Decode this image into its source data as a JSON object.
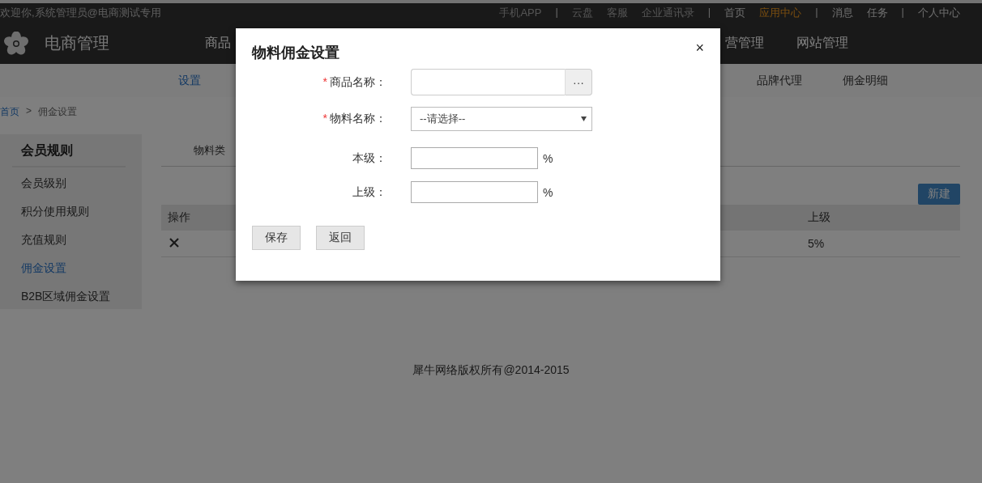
{
  "top_bar": {
    "welcome": "欢迎你,系统管理员@电商测试专用",
    "links": [
      {
        "label": "手机APP",
        "disabled": true,
        "selected": false
      },
      {
        "label": "|",
        "kind": "sep"
      },
      {
        "label": "云盘",
        "disabled": true,
        "selected": false
      },
      {
        "label": "客服",
        "disabled": true,
        "selected": false
      },
      {
        "label": "企业通讯录",
        "disabled": true,
        "selected": false
      },
      {
        "label": "|",
        "kind": "sep"
      },
      {
        "label": "首页",
        "disabled": false,
        "selected": false
      },
      {
        "label": "应用中心",
        "disabled": false,
        "selected": true
      },
      {
        "label": "|",
        "kind": "sep"
      },
      {
        "label": "消息",
        "disabled": false,
        "selected": false
      },
      {
        "label": "任务",
        "disabled": false,
        "selected": false
      },
      {
        "label": "|",
        "kind": "sep"
      },
      {
        "label": "个人中心",
        "disabled": false,
        "selected": false
      }
    ]
  },
  "header": {
    "app_name": "电商管理",
    "nav": [
      "商品",
      "营管理",
      "网站管理"
    ]
  },
  "sub_nav": [
    {
      "label": "设置",
      "selected": true
    },
    {
      "label": "品牌代理",
      "selected": false
    },
    {
      "label": "佣金明细",
      "selected": false
    }
  ],
  "breadcrumb": [
    "首页",
    ">",
    "佣金设置"
  ],
  "sidebar": {
    "title": "会员规则",
    "items": [
      {
        "label": "会员级别",
        "selected": false
      },
      {
        "label": "积分使用规则",
        "selected": false
      },
      {
        "label": "充值规则",
        "selected": false
      },
      {
        "label": "佣金设置",
        "selected": true
      },
      {
        "label": "B2B区域佣金设置",
        "selected": false
      }
    ]
  },
  "content": {
    "tab": "物料类",
    "new_button": "新建",
    "table": {
      "columns": [
        "操作",
        "上级"
      ],
      "rows": [
        {
          "column_2": "5%"
        }
      ]
    }
  },
  "footer": "犀牛网络版权所有@2014-2015",
  "dialog": {
    "title": "物料佣金设置",
    "close": "×",
    "fields": [
      {
        "label": "商品名称：",
        "required_mark": "*",
        "kind": "picker",
        "button": "···"
      },
      {
        "label": "物料名称：",
        "required_mark": "*",
        "kind": "select",
        "value": "--请选择--"
      },
      {
        "label": "本级：",
        "kind": "percent",
        "unit": "%"
      },
      {
        "label": "上级：",
        "kind": "percent",
        "unit": "%"
      }
    ],
    "buttons": [
      "保存",
      "返回"
    ]
  }
}
